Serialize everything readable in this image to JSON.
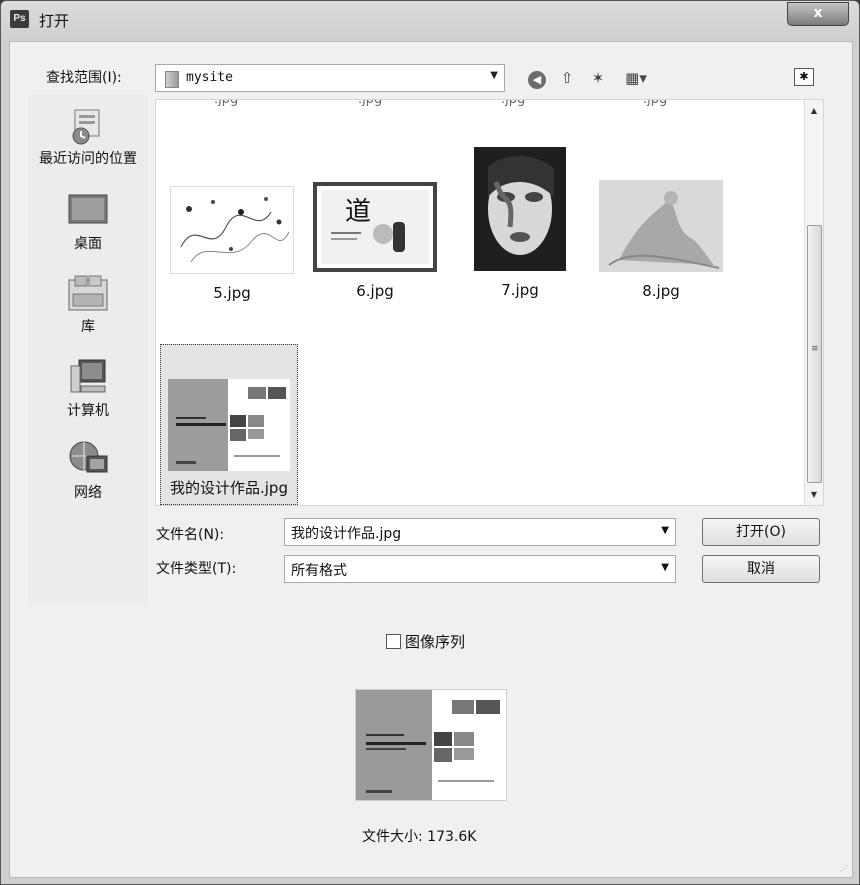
{
  "window": {
    "title": "打开",
    "app_badge": "Ps",
    "close_glyph": "x"
  },
  "toolbar": {
    "look_in_label": "查找范围(I):",
    "look_in_value": "mysite",
    "back_icon": "back-icon",
    "up_icon": "up-folder-icon",
    "new_folder_icon": "new-folder-icon",
    "view_icon": "view-menu-icon",
    "glyphs": {
      "back": "◀",
      "up": "⇧",
      "new": "✶",
      "view": "▦▾",
      "arrow": "▼",
      "star": "✱"
    }
  },
  "places": [
    {
      "label": "最近访问的位置",
      "icon": "recent-places-icon"
    },
    {
      "label": "桌面",
      "icon": "desktop-icon"
    },
    {
      "label": "库",
      "icon": "library-icon"
    },
    {
      "label": "计算机",
      "icon": "computer-icon"
    },
    {
      "label": "网络",
      "icon": "network-icon"
    }
  ],
  "files": {
    "top_cut_labels": [
      ".jpg",
      ".jpg",
      ".jpg",
      ".jpg"
    ],
    "items": [
      {
        "name": "5.jpg"
      },
      {
        "name": "6.jpg"
      },
      {
        "name": "7.jpg"
      },
      {
        "name": "8.jpg"
      },
      {
        "name": "我的设计作品.jpg",
        "selected": true
      }
    ],
    "thumb_texts": {
      "dao": "道"
    }
  },
  "form": {
    "filename_label": "文件名(N):",
    "filename_value": "我的设计作品.jpg",
    "filetype_label": "文件类型(T):",
    "filetype_value": "所有格式",
    "open_button": "打开(O)",
    "cancel_button": "取消",
    "image_sequence_label": "图像序列",
    "image_sequence_checked": false
  },
  "preview": {
    "file_size_text": "文件大小: 173.6K"
  },
  "colors": {
    "window_bg": "#f0f0f0",
    "list_bg": "#ffffff",
    "title_bg": "#d6d6d6"
  }
}
